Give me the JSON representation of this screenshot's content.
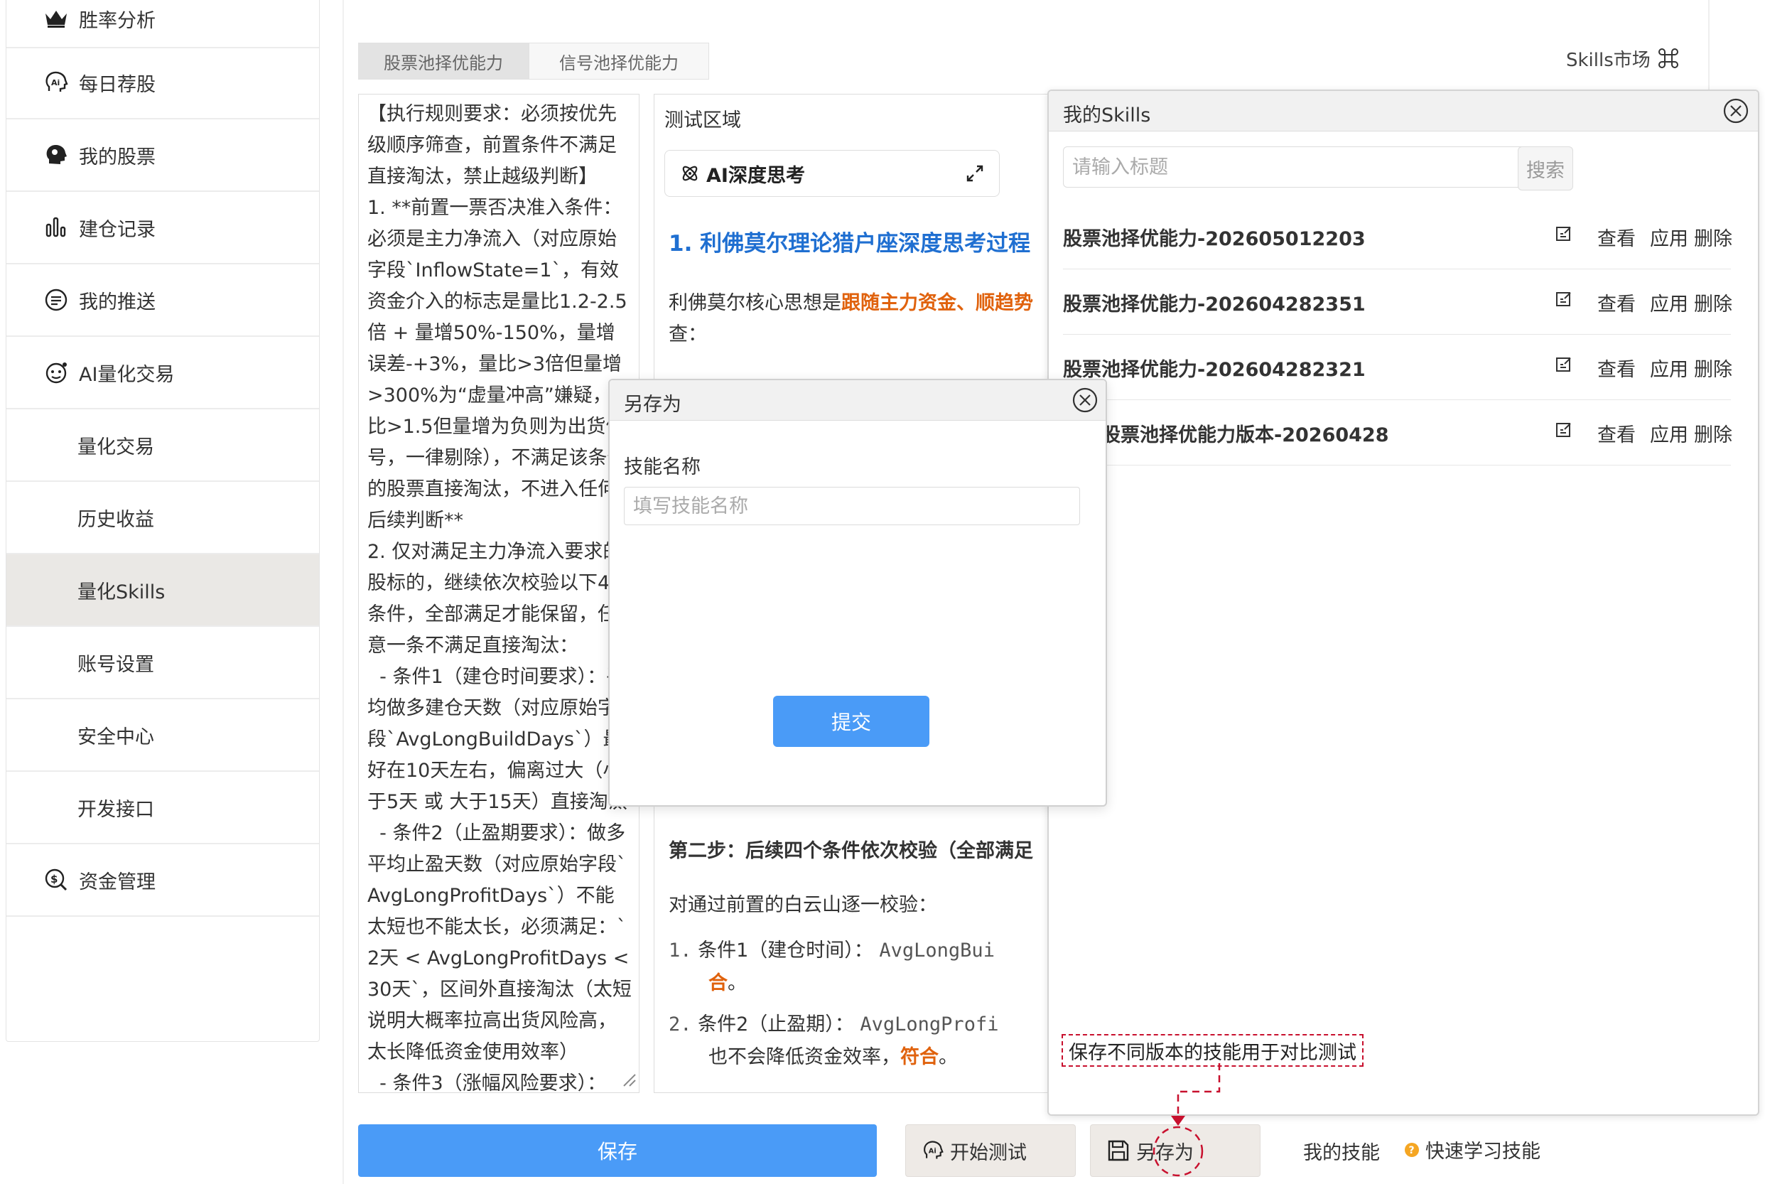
{
  "sidebar": {
    "items": [
      {
        "label": "胜率分析",
        "icon": "crown-icon"
      },
      {
        "label": "每日荐股",
        "icon": "ai-head-icon"
      },
      {
        "label": "我的股票",
        "icon": "brain-icon"
      },
      {
        "label": "建仓记录",
        "icon": "bar-chart-icon"
      },
      {
        "label": "我的推送",
        "icon": "message-icon"
      },
      {
        "label": "AI量化交易",
        "icon": "robot-icon"
      },
      {
        "label": "量化交易"
      },
      {
        "label": "历史收益"
      },
      {
        "label": "量化Skills",
        "active": true
      },
      {
        "label": "账号设置"
      },
      {
        "label": "安全中心"
      },
      {
        "label": "开发接口"
      },
      {
        "label": "资金管理",
        "icon": "money-search-icon"
      }
    ]
  },
  "tabs": [
    "股票池择优能力",
    "信号池择优能力"
  ],
  "skills_market": {
    "label": "Skills市场",
    "icon": "command-icon"
  },
  "rule_text": "【执行规则要求：必须按优先级顺序筛查，前置条件不满足直接淘汰，禁止越级判断】\n1. **前置一票否决准入条件：必须是主力净流入（对应原始字段`InflowState=1`，有效资金介入的标志是量比1.2-2.5倍 + 量增50%-150%，量增误差-+3%，量比>3倍但量增>300%为“虚量冲高”嫌疑，量比>1.5但量增为负则为出货信号，一律剔除），不满足该条件的股票直接淘汰，不进入任何后续判断**\n2. 仅对满足主力净流入要求的股标的，继续依次校验以下4个条件，全部满足才能保留，任意一条不满足直接淘汰：\n  - 条件1（建仓时间要求）：平均做多建仓天数（对应原始字段`AvgLongBuildDays`）最好在10天左右，偏离过大（小于5天 或 大于15天）直接淘汰\n  - 条件2（止盈期要求）：做多平均止盈天数（对应原始字段`AvgLongProfitDays`）不能太短也不能太长，必须满足：`2天 < AvgLongProfitDays < 30天`，区间外直接淘汰（太短说明大概率拉高出货风险高，太长降低资金使用效率）\n  - 条件3（涨幅风险要求）：",
  "test_area": {
    "title": "测试区域",
    "thinking_label": "AI深度思考",
    "heading1": "1. 利佛莫尔理论猎户座深度思考过程",
    "para1_prefix": "利佛莫尔核心思想是",
    "para1_highlight": "跟随主力资金、顺趋势",
    "para1_line2": "查：",
    "step2": "第二步：后续四个条件依次校验（全部满足",
    "para2": "对通过前置的白云山逐一校验：",
    "list": [
      {
        "num": "1.",
        "label": "条件1（建仓时间）：",
        "code": "AvgLongBui",
        "line2": "合",
        "line2_tail": "。"
      },
      {
        "num": "2.",
        "label": "条件2（止盈期）：",
        "code": "AvgLongProfi",
        "line2": "也不会降低资金效率，",
        "line2_highlight": "符合",
        "line2_tail": "。"
      }
    ]
  },
  "my_skills": {
    "title": "我的Skills",
    "search_placeholder": "请输入标题",
    "search_button": "搜索",
    "rows": [
      {
        "name": "股票池择优能力-202605012203",
        "view": "查看",
        "apply": "应用",
        "delete": "删除"
      },
      {
        "name": "股票池择优能力-202604282351",
        "view": "查看",
        "apply": "应用",
        "delete": "删除"
      },
      {
        "name": "股票池择优能力-202604282321",
        "view": "查看",
        "apply": "应用",
        "delete": "删除"
      },
      {
        "name": "我的股票池择优能力版本-20260428",
        "view": "查看",
        "apply": "应用",
        "delete": "删除"
      }
    ],
    "tip": "保存不同版本的技能用于对比测试"
  },
  "save_as_dialog": {
    "title": "另存为",
    "field_label": "技能名称",
    "placeholder": "填写技能名称",
    "submit": "提交"
  },
  "bottom_bar": {
    "save": "保存",
    "start_test": "开始测试",
    "save_as": "另存为",
    "my_skills": "我的技能",
    "quick_learn": "快速学习技能"
  },
  "colors": {
    "primary": "#4a9bf7",
    "heading_blue": "#1f6fd1",
    "highlight_orange": "#e0620d",
    "annotation_red": "#c8102e",
    "quick_learn_icon": "#f5a623"
  }
}
